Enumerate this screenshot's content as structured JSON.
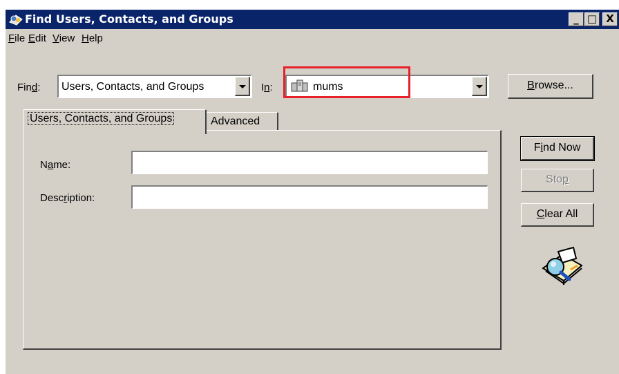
{
  "window": {
    "title": "Find Users, Contacts, and Groups",
    "controls": {
      "minimize": "_",
      "maximize": "□",
      "close": "X"
    }
  },
  "menu": [
    {
      "key": "F",
      "rest": "ile"
    },
    {
      "key": "E",
      "rest": "dit"
    },
    {
      "key": "V",
      "rest": "iew"
    },
    {
      "key": "H",
      "rest": "elp"
    }
  ],
  "find": {
    "label_pre": "Fin",
    "label_key": "d",
    "label_post": ":",
    "value": "Users, Contacts, and Groups"
  },
  "in": {
    "label_pre": "I",
    "label_key": "n",
    "label_post": ":",
    "value": "mums",
    "icon": "domain-icon"
  },
  "browse": {
    "key": "B",
    "rest": "rowse..."
  },
  "tabs": {
    "users": "Users, Contacts, and Groups",
    "advanced": "Advanced"
  },
  "fields": {
    "name": {
      "pre": "N",
      "key": "a",
      "post": "me:",
      "value": ""
    },
    "description": {
      "pre": "Desc",
      "key": "r",
      "post": "iption:",
      "value": ""
    }
  },
  "buttons": {
    "find_now": {
      "pre": "F",
      "key": "i",
      "post": "nd Now"
    },
    "stop": {
      "pre": "Sto",
      "key": "p",
      "post": ""
    },
    "clear_all": {
      "pre": "",
      "key": "C",
      "post": "lear All"
    }
  },
  "colors": {
    "titlebar": "#0a246a",
    "face": "#d4d0c8",
    "highlight": "#e8202a"
  }
}
